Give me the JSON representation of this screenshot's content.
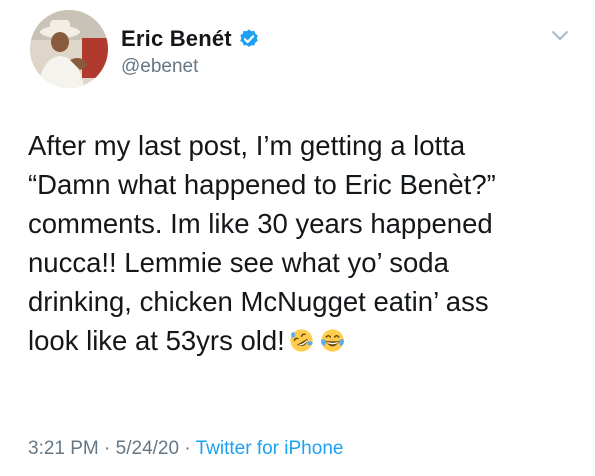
{
  "user": {
    "display_name": "Eric Benét",
    "handle": "@ebenet",
    "verified": true
  },
  "tweet": {
    "text_lines": [
      "After my last post, I’m getting a lotta",
      "“Damn what happened to Eric Benèt?”",
      "comments. Im like 30 years happened",
      "nucca!! Lemmie see what yo’ soda",
      "drinking, chicken McNugget eatin’ ass",
      "look like at 53yrs old!"
    ],
    "emojis": [
      "rolling-on-floor-laughing-emoji",
      "face-with-tears-of-joy-emoji"
    ]
  },
  "meta": {
    "time": "3:21 PM",
    "separator": "·",
    "date": "5/24/20",
    "source": "Twitter for iPhone"
  },
  "colors": {
    "text": "#14171a",
    "secondary": "#657786",
    "accent": "#1da1f2"
  }
}
